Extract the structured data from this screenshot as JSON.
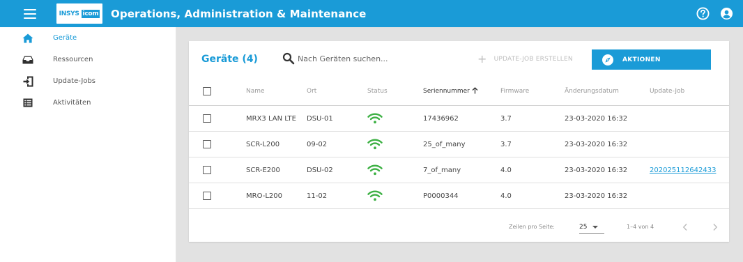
{
  "header": {
    "logo_left": "INSYS",
    "logo_right": "icom",
    "title": "Operations, Administration & Maintenance",
    "icons": [
      "hamburger-menu-icon",
      "help-icon",
      "account-icon"
    ]
  },
  "sidebar": {
    "items": [
      {
        "label": "Geräte",
        "icon": "home-icon",
        "active": true
      },
      {
        "label": "Ressourcen",
        "icon": "inbox-icon",
        "active": false
      },
      {
        "label": "Update-Jobs",
        "icon": "import-icon",
        "active": false
      },
      {
        "label": "Aktivitäten",
        "icon": "list-icon",
        "active": false
      }
    ]
  },
  "card": {
    "title": "Geräte (4)",
    "search_placeholder": "Nach Geräten suchen...",
    "create_job_label": "UPDATE-JOB ERSTELLEN",
    "actions_label": "AKTIONEN"
  },
  "table": {
    "columns": {
      "name": "Name",
      "ort": "Ort",
      "status": "Status",
      "serial": "Seriennummer",
      "firmware": "Firmware",
      "date": "Änderungsdatum",
      "job": "Update-Job"
    },
    "rows": [
      {
        "name": "MRX3 LAN LTE",
        "ort": "DSU-01",
        "status": "online",
        "serial": "17436962",
        "firmware": "3.7",
        "date": "23-03-2020 16:32",
        "job": ""
      },
      {
        "name": "SCR-L200",
        "ort": "09-02",
        "status": "online",
        "serial": "25_of_many",
        "firmware": "3.7",
        "date": "23-03-2020 16:32",
        "job": ""
      },
      {
        "name": "SCR-E200",
        "ort": "DSU-02",
        "status": "online",
        "serial": "7_of_many",
        "firmware": "4.0",
        "date": "23-03-2020 16:32",
        "job": "202025112642433"
      },
      {
        "name": "MRO-L200",
        "ort": "11-02",
        "status": "online",
        "serial": "P0000344",
        "firmware": "4.0",
        "date": "23-03-2020 16:32",
        "job": ""
      }
    ]
  },
  "pagination": {
    "rows_per_page_label": "Zeilen pro Seite:",
    "rows_per_page": "25",
    "range": "1–4 von 4"
  },
  "colors": {
    "brand": "#1a9bd7",
    "wifi": "#3cb043"
  }
}
